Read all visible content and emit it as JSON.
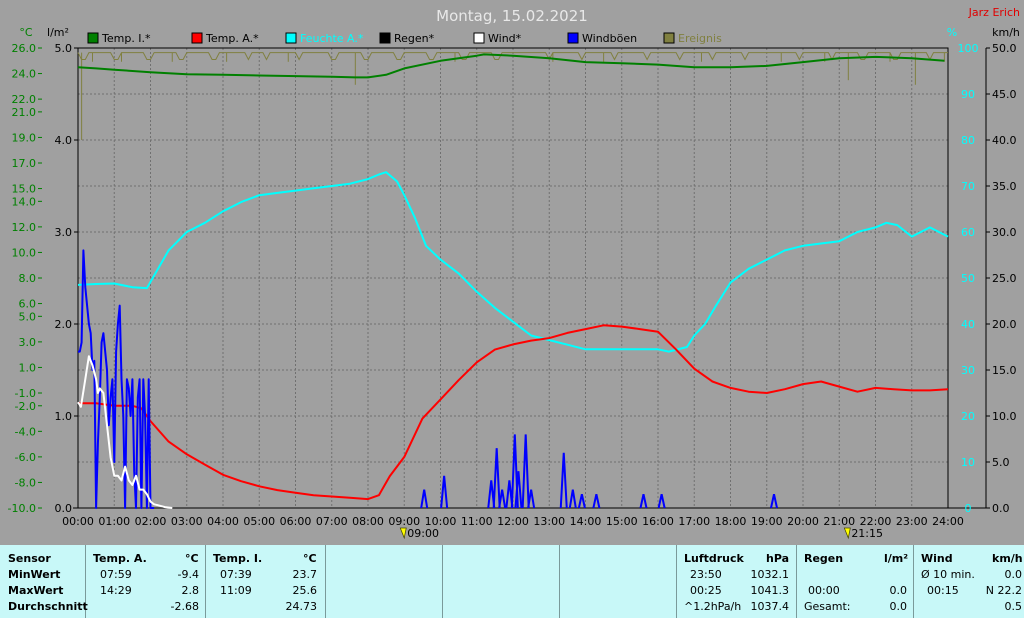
{
  "chart_data": {
    "type": "line",
    "title": "Montag, 15.02.2021",
    "author": "Jarz Erich",
    "x_ticks": [
      "00:00",
      "01:00",
      "02:00",
      "03:00",
      "04:00",
      "05:00",
      "06:00",
      "07:00",
      "08:00",
      "09:00",
      "10:00",
      "11:00",
      "12:00",
      "13:00",
      "14:00",
      "15:00",
      "16:00",
      "17:00",
      "18:00",
      "19:00",
      "20:00",
      "21:00",
      "22:00",
      "23:00",
      "24:00"
    ],
    "xlim": [
      0,
      24
    ],
    "axes": {
      "temp": {
        "unit": "°C",
        "ticks": [
          "26.0",
          "24.0",
          "22.0",
          "21.0",
          "19.0",
          "17.0",
          "15.0",
          "14.0",
          "12.0",
          "10.0",
          "8.0",
          "6.0",
          "5.0",
          "3.0",
          "1.0",
          "-1.0",
          "-2.0",
          "-4.0",
          "-6.0",
          "-8.0",
          "-10.0"
        ],
        "range": [
          -10,
          26
        ]
      },
      "rain": {
        "unit": "l/m²",
        "ticks": [
          "5.0",
          "4.0",
          "3.0",
          "2.0",
          "1.0",
          "0.0"
        ],
        "range": [
          0,
          5
        ]
      },
      "humidity": {
        "unit": "%",
        "ticks": [
          "100",
          "90",
          "80",
          "70",
          "60",
          "50",
          "40",
          "30",
          "20",
          "10",
          "0"
        ],
        "range": [
          0,
          100
        ]
      },
      "wind": {
        "unit": "km/h",
        "ticks": [
          "50.0",
          "45.0",
          "40.0",
          "35.0",
          "30.0",
          "25.0",
          "20.0",
          "15.0",
          "10.0",
          "5.0",
          "0.0"
        ],
        "range": [
          0,
          50
        ]
      }
    },
    "markers": [
      {
        "x": 9.0,
        "label": "09:00"
      },
      {
        "x": 21.25,
        "label": "21:15"
      }
    ],
    "legend": [
      {
        "name": "Temp. I.*",
        "color": "#008000"
      },
      {
        "name": "Temp. A.*",
        "color": "#ff0000"
      },
      {
        "name": "Feuchte A.*",
        "color": "#00ffff"
      },
      {
        "name": "Regen*",
        "color": "#000000"
      },
      {
        "name": "Wind*",
        "color": "#ffffff"
      },
      {
        "name": "Windböen",
        "color": "#0000ff"
      },
      {
        "name": "Ereignis",
        "color": "#808040"
      }
    ],
    "series": [
      {
        "name": "Temp. I.*",
        "axis": "temp",
        "color": "#008000",
        "x": [
          0,
          0.5,
          1,
          2,
          3,
          4,
          5,
          6,
          7,
          7.65,
          8,
          8.5,
          9,
          10,
          11,
          11.2,
          12,
          13,
          14,
          15,
          16,
          17,
          18,
          19,
          20,
          21,
          22,
          23,
          23.9
        ],
        "y": [
          24.5,
          24.4,
          24.3,
          24.1,
          23.95,
          23.9,
          23.85,
          23.8,
          23.75,
          23.7,
          23.7,
          23.9,
          24.4,
          25.0,
          25.4,
          25.5,
          25.4,
          25.2,
          24.9,
          24.8,
          24.7,
          24.5,
          24.5,
          24.6,
          24.9,
          25.2,
          25.3,
          25.2,
          25.0
        ]
      },
      {
        "name": "Temp. A.*",
        "axis": "temp",
        "color": "#ff0000",
        "x": [
          0,
          0.5,
          1,
          1.5,
          1.75,
          2,
          2.5,
          3,
          3.5,
          4,
          4.5,
          5,
          5.5,
          6,
          6.5,
          7,
          7.5,
          8,
          8.3,
          8.6,
          9,
          9.5,
          10,
          10.5,
          11,
          11.5,
          12,
          12.5,
          13,
          13.5,
          14,
          14.5,
          15,
          15.5,
          16,
          16.5,
          17,
          17.5,
          18,
          18.5,
          19,
          19.5,
          20,
          20.5,
          21,
          21.5,
          22,
          22.5,
          23,
          23.5,
          24
        ],
        "y": [
          -1.8,
          -1.8,
          -2.0,
          -2.0,
          -2.2,
          -3.2,
          -4.8,
          -5.8,
          -6.6,
          -7.4,
          -7.9,
          -8.3,
          -8.6,
          -8.8,
          -9.0,
          -9.1,
          -9.2,
          -9.3,
          -9.0,
          -7.5,
          -6.0,
          -3.0,
          -1.5,
          0.0,
          1.4,
          2.4,
          2.8,
          3.1,
          3.3,
          3.7,
          4.0,
          4.3,
          4.2,
          4.0,
          3.8,
          2.4,
          0.9,
          -0.1,
          -0.6,
          -0.9,
          -1.0,
          -0.7,
          -0.3,
          -0.1,
          -0.5,
          -0.9,
          -0.6,
          -0.7,
          -0.8,
          -0.8,
          -0.7
        ]
      },
      {
        "name": "Feuchte A.*",
        "axis": "humidity",
        "color": "#00ffff",
        "x": [
          0,
          0.5,
          1,
          1.5,
          1.9,
          2.5,
          3,
          3.5,
          4,
          4.5,
          5,
          5.5,
          6,
          6.5,
          7,
          7.5,
          8,
          8.3,
          8.5,
          8.8,
          9,
          9.3,
          9.6,
          10,
          10.5,
          11,
          11.5,
          12,
          12.5,
          13,
          13.5,
          14,
          14.5,
          15,
          15.5,
          16,
          16.3,
          16.8,
          17,
          17.3,
          17.6,
          18,
          18.5,
          19,
          19.5,
          20,
          20.5,
          21,
          21.5,
          22,
          22.3,
          22.6,
          23,
          23.5,
          24
        ],
        "y": [
          48.5,
          48.7,
          48.8,
          48,
          47.8,
          56,
          60,
          62,
          64.5,
          66.5,
          68,
          68.5,
          69,
          69.5,
          70,
          70.5,
          71.5,
          72.5,
          73,
          71,
          68,
          63,
          57,
          54,
          51,
          47,
          43.5,
          40.5,
          37.5,
          36.5,
          35.5,
          34.5,
          34.5,
          34.5,
          34.5,
          34.5,
          34,
          35,
          37.5,
          40,
          44,
          49,
          52,
          54,
          56,
          57,
          57.5,
          58,
          60,
          61,
          62,
          61.5,
          59,
          61,
          59
        ]
      },
      {
        "name": "Wind*",
        "axis": "wind",
        "color": "#ffffff",
        "x": [
          0,
          0.08,
          0.2,
          0.3,
          0.4,
          0.5,
          0.55,
          0.6,
          0.7,
          0.8,
          0.9,
          1.0,
          1.1,
          1.2,
          1.3,
          1.4,
          1.5,
          1.6,
          1.7,
          1.8,
          1.9,
          2.0,
          2.1,
          2.2,
          2.4,
          2.6
        ],
        "y": [
          11.5,
          11,
          14,
          16.5,
          15.5,
          14,
          12.5,
          13,
          12.5,
          9,
          5.5,
          3.5,
          3.5,
          3.0,
          4.5,
          3.0,
          2.5,
          3.5,
          2,
          2,
          1.5,
          0.7,
          0.4,
          0.3,
          0.1,
          0
        ]
      },
      {
        "name": "Windböen",
        "axis": "wind",
        "color": "#0000ff",
        "x": [
          0,
          0.05,
          0.1,
          0.15,
          0.2,
          0.25,
          0.3,
          0.35,
          0.4,
          0.45,
          0.5,
          0.55,
          0.6,
          0.65,
          0.7,
          0.75,
          0.8,
          0.85,
          0.9,
          0.95,
          1.0,
          1.05,
          1.1,
          1.15,
          1.2,
          1.25,
          1.3,
          1.35,
          1.4,
          1.45,
          1.5,
          1.55,
          1.6,
          1.65,
          1.7,
          1.75,
          1.8,
          1.85,
          1.9,
          1.95,
          2.0,
          2.05,
          2.1
        ],
        "y": [
          17,
          17,
          18,
          28,
          24,
          22,
          20,
          19,
          15,
          16,
          0,
          7,
          12,
          18,
          19,
          17,
          15,
          9,
          12,
          14,
          5,
          17,
          20,
          22,
          14,
          10,
          0,
          14,
          13,
          10,
          14,
          4,
          0,
          12,
          14,
          0,
          14,
          10,
          0,
          14,
          0,
          0,
          0
        ]
      }
    ],
    "gust_bursts": [
      [
        9.55,
        2
      ],
      [
        10.1,
        3.5
      ],
      [
        11.4,
        3
      ],
      [
        11.55,
        6.5
      ],
      [
        11.7,
        2
      ],
      [
        11.9,
        3
      ],
      [
        12.05,
        8
      ],
      [
        12.15,
        4
      ],
      [
        12.35,
        8
      ],
      [
        12.5,
        2
      ],
      [
        13.4,
        6
      ],
      [
        13.65,
        2
      ],
      [
        13.9,
        1.5
      ],
      [
        14.3,
        1.5
      ],
      [
        15.6,
        1.5
      ],
      [
        16.1,
        1.5
      ],
      [
        19.2,
        1.5
      ]
    ],
    "ereignis_baseline": 99,
    "ereignis_spikes": [
      [
        0.1,
        80
      ],
      [
        0.4,
        97
      ],
      [
        1.2,
        97
      ],
      [
        2.6,
        97
      ],
      [
        4.1,
        97
      ],
      [
        5.8,
        97
      ],
      [
        7.65,
        92
      ],
      [
        10.4,
        97
      ],
      [
        13.1,
        97
      ],
      [
        14.5,
        97
      ],
      [
        17.2,
        97
      ],
      [
        19.4,
        97
      ],
      [
        20.6,
        97
      ],
      [
        21.25,
        93
      ],
      [
        22.4,
        97
      ],
      [
        23.1,
        92
      ],
      [
        23.9,
        97
      ]
    ]
  },
  "footer": {
    "col1": {
      "header": "Sensor",
      "rows": [
        "MinWert",
        "MaxWert",
        "Durchschnitt"
      ]
    },
    "col2": {
      "header": "Temp. A.",
      "unit": "°C",
      "times": [
        "07:59",
        "14:29",
        ""
      ],
      "values": [
        "-9.4",
        "2.8",
        "-2.68"
      ]
    },
    "col3": {
      "header": "Temp. I.",
      "unit": "°C",
      "times": [
        "07:39",
        "11:09",
        ""
      ],
      "values": [
        "23.7",
        "25.6",
        "24.73"
      ]
    },
    "col4": {
      "header": "Luftdruck",
      "unit": "hPa",
      "times": [
        "23:50",
        "00:25",
        "^1.2hPa/h"
      ],
      "values": [
        "1032.1",
        "1041.3",
        "1037.4"
      ]
    },
    "col5": {
      "header": "Regen",
      "unit": "l/m²",
      "times": [
        "",
        "00:00",
        "Gesamt:"
      ],
      "values": [
        "",
        "0.0",
        "0.0"
      ]
    },
    "col6": {
      "header": "Wind",
      "unit": "km/h",
      "times": [
        "Ø 10 min.",
        "00:15",
        ""
      ],
      "values": [
        "0.0",
        "N 22.2",
        "0.5"
      ]
    }
  }
}
